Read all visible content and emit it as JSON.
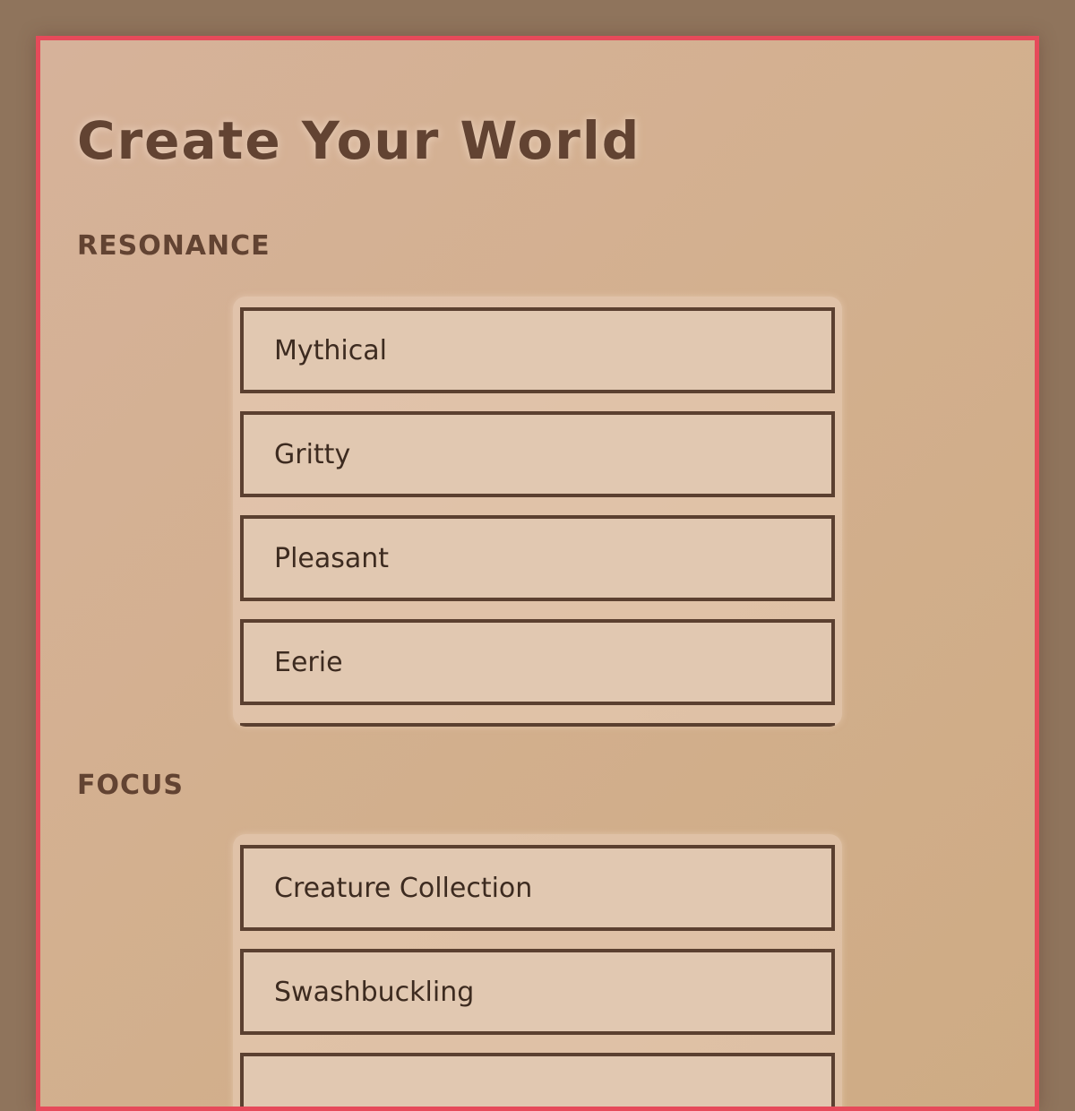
{
  "page": {
    "title": "Create Your World"
  },
  "sections": {
    "resonance": {
      "label": "RESONANCE",
      "options": [
        "Mythical",
        "Gritty",
        "Pleasant",
        "Eerie"
      ]
    },
    "focus": {
      "label": "FOCUS",
      "options": [
        "Creature Collection",
        "Swashbuckling"
      ]
    }
  },
  "colors": {
    "outer_background": "#8f745c",
    "frame_border": "#e64a5a",
    "text": "#624332",
    "option_border": "#5b4030",
    "option_fill": "#e1c8b1"
  }
}
